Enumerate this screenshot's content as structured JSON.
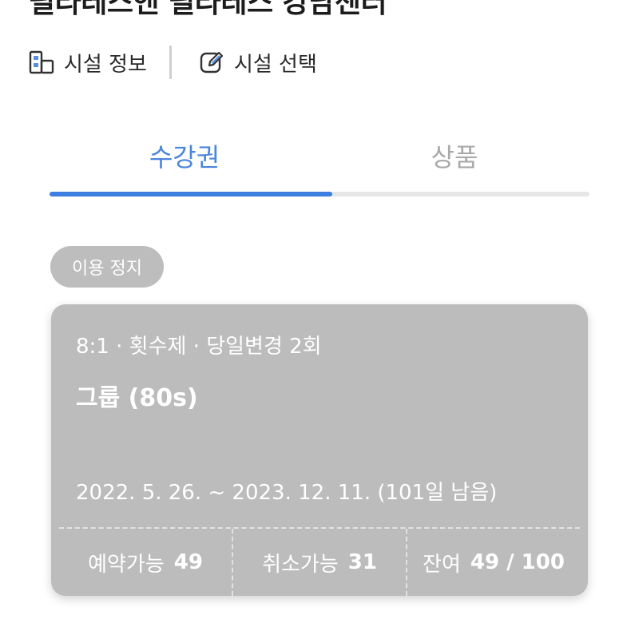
{
  "header": {
    "title": "필라테스앤 필라테스 강남센터"
  },
  "actions": {
    "facility_info": {
      "label": "시설 정보",
      "icon": "building-icon"
    },
    "facility_select": {
      "label": "시설 선택",
      "icon": "edit-icon"
    }
  },
  "tabs": [
    {
      "label": "수강권",
      "active": true
    },
    {
      "label": "상품",
      "active": false
    }
  ],
  "colors": {
    "accent": "#3d7fe0",
    "tab_active_text": "#4a86dc",
    "tab_inactive_text": "#a9a9a9",
    "card_background": "#bcbcbc",
    "badge_background": "#bdbdbd"
  },
  "pass": {
    "status_badge": "이용 정지",
    "meta": "8:1 · 횟수제 · 당일변경 2회",
    "name": "그룹 (80s)",
    "period": "2022. 5. 26. ~ 2023. 12. 11. (101일 남음)",
    "stats": [
      {
        "label": "예약가능",
        "value": "49"
      },
      {
        "label": "취소가능",
        "value": "31"
      },
      {
        "label": "잔여",
        "value": "49 / 100"
      }
    ]
  }
}
